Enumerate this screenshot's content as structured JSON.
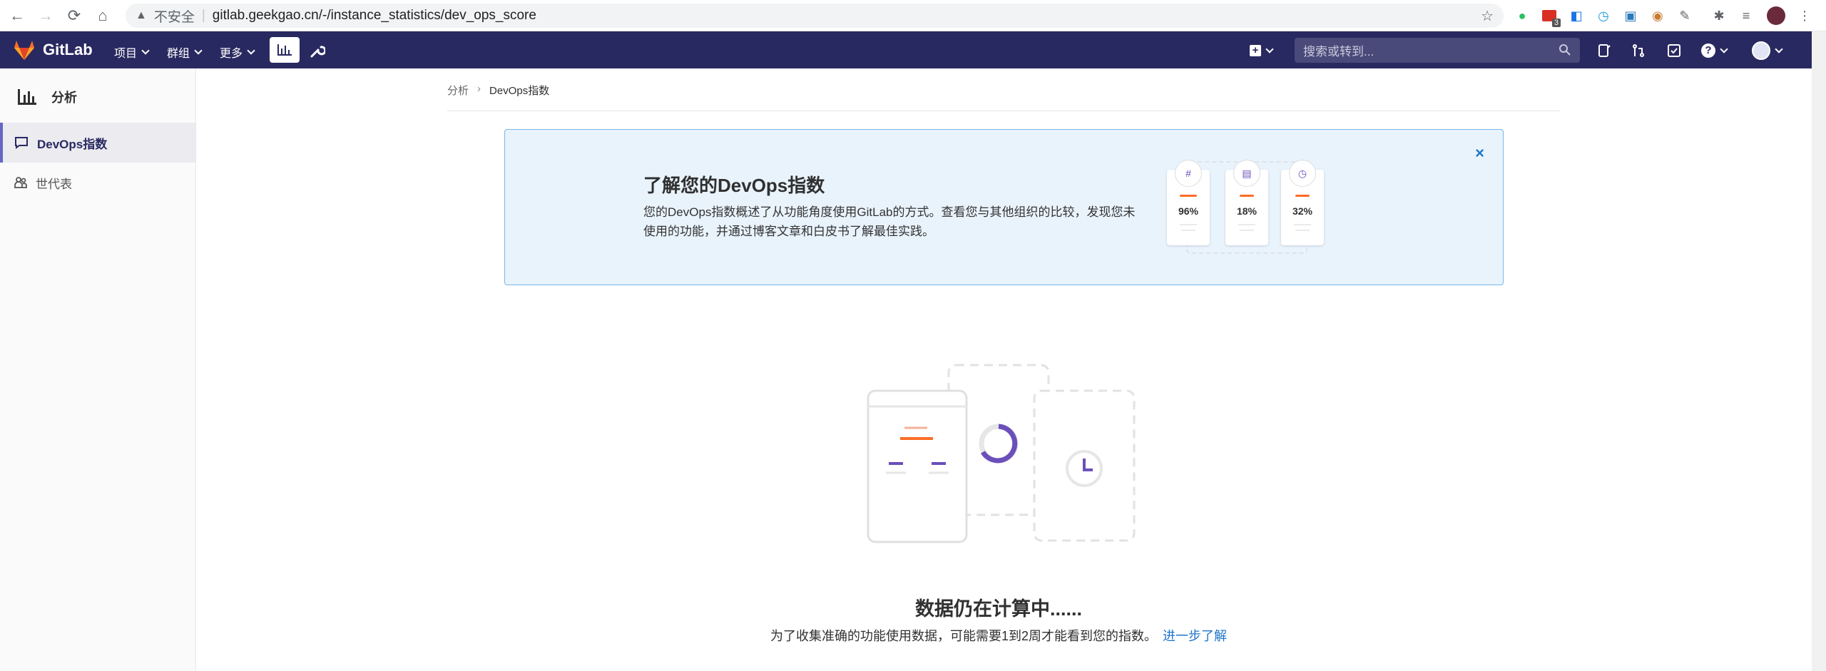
{
  "browser": {
    "insecure_label": "不安全",
    "url": "gitlab.geekgao.cn/-/instance_statistics/dev_ops_score",
    "ext_badge": "3"
  },
  "topnav": {
    "brand": "GitLab",
    "menus": [
      "项目",
      "群组",
      "更多"
    ],
    "search_placeholder": "搜索或转到..."
  },
  "sidebar": {
    "title": "分析",
    "items": [
      {
        "label": "DevOps指数",
        "active": true
      },
      {
        "label": "世代表",
        "active": false
      }
    ]
  },
  "breadcrumb": [
    "分析",
    "DevOps指数"
  ],
  "banner": {
    "title": "了解您的DevOps指数",
    "text": "您的DevOps指数概述了从功能角度使用GitLab的方式。查看您与其他组织的比较，发现您未使用的功能，并通过博客文章和白皮书了解最佳实践。",
    "close_symbol": "×",
    "cards": [
      {
        "icon": "#",
        "value": "96%"
      },
      {
        "icon": "▤",
        "value": "18%"
      },
      {
        "icon": "◷",
        "value": "32%"
      }
    ]
  },
  "empty_state": {
    "title": "数据仍在计算中......",
    "text": "为了收集准确的功能使用数据，可能需要1到2周才能看到您的指数。",
    "link": "进一步了解"
  },
  "colors": {
    "nav": "#292961",
    "accent": "#fc6d26",
    "purple": "#6b4fbb",
    "link": "#1f75cb"
  }
}
